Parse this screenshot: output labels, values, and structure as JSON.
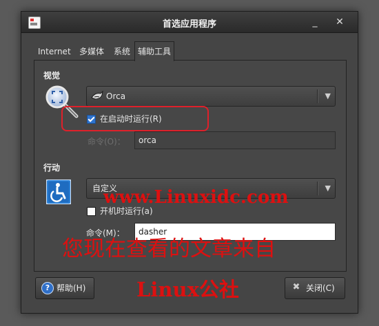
{
  "window": {
    "title": "首选应用程序"
  },
  "tabs": [
    "Internet",
    "多媒体",
    "系统",
    "辅助工具"
  ],
  "visual": {
    "section_title": "视觉",
    "app_combo": "Orca",
    "run_at_start": {
      "label": "在启动时运行(R)",
      "checked": true
    },
    "command": {
      "label": "命令(O)：",
      "value": "orca"
    }
  },
  "mobility": {
    "section_title": "行动",
    "app_combo": "自定义",
    "run_at_start": {
      "label": "开机时运行(a)",
      "checked": false
    },
    "command": {
      "label": "命令(M)：",
      "value": "dasher"
    }
  },
  "buttons": {
    "help": "帮助(H)",
    "close": "关闭(C)"
  },
  "watermarks": {
    "line1": "www.Linuxidc.com",
    "line2": "您现在查看的文章来自",
    "line3": "Linux公社"
  },
  "colors": {
    "accent_red": "#e0202a",
    "check_blue": "#2e74d0"
  }
}
